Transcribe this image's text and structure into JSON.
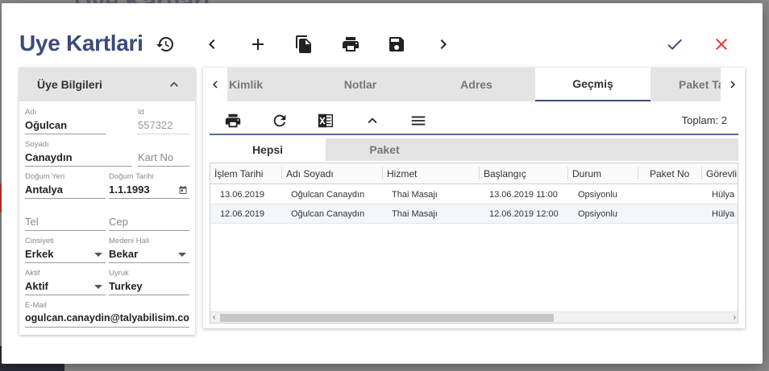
{
  "background": {
    "title": "Uye Kartlari"
  },
  "header": {
    "title": "Uye Kartlari",
    "buttons": [
      "history-icon",
      "chevron-left-icon",
      "plus-icon",
      "copy-icon",
      "print-icon",
      "save-icon",
      "chevron-right-icon",
      "check-icon",
      "close-icon"
    ],
    "accent": "#3b4a7a",
    "confirm_color": "#3b4a7a",
    "cancel_color": "#e53935"
  },
  "left_panel": {
    "title": "Üye Bilgileri",
    "fields": {
      "adi": {
        "label": "Adı",
        "value": "Oğulcan"
      },
      "id": {
        "label": "Id",
        "value": "557322"
      },
      "soyadi": {
        "label": "Soyadı",
        "value": "Canaydın"
      },
      "kart_no": {
        "placeholder": "Kart No"
      },
      "dogum_yeri": {
        "label": "Doğum Yeri",
        "value": "Antalya"
      },
      "dogum_tarihi": {
        "label": "Doğum Tarihi",
        "value": "1.1.1993"
      },
      "tel": {
        "placeholder": "Tel"
      },
      "cep": {
        "placeholder": "Cep"
      },
      "cinsiyeti": {
        "label": "Cinsiyeti",
        "value": "Erkek"
      },
      "medeni_hali": {
        "label": "Medeni Hali",
        "value": "Bekar"
      },
      "aktif": {
        "label": "Aktif",
        "value": "Aktif"
      },
      "uyruk": {
        "label": "Uyruk",
        "value": "Turkey"
      },
      "email": {
        "label": "E-Mail",
        "value": "ogulcan.canaydin@talyabilisim.com"
      }
    }
  },
  "right_panel": {
    "tabs": [
      "Kimlik",
      "Notlar",
      "Adres",
      "Geçmiş",
      "Paket Ta"
    ],
    "active_tab": "Geçmiş",
    "total_label": "Toplam: 2",
    "subtabs": [
      "Hepsi",
      "Paket"
    ],
    "active_subtab": "Hepsi",
    "columns": [
      "İşlem Tarihi",
      "Adı Soyadı",
      "Hizmet",
      "Başlangıç",
      "Durum",
      "Paket No",
      "Görevli"
    ],
    "rows": [
      [
        "13.06.2019",
        "Oğulcan Canaydın",
        "Thai Masajı",
        "13.06.2019 11:00",
        "Opsiyonlu",
        "",
        "Hülya"
      ],
      [
        "12.06.2019",
        "Oğulcan Canaydın",
        "Thai Masajı",
        "12.06.2019 12:00",
        "Opsiyonlu",
        "",
        "Hülya"
      ]
    ]
  }
}
